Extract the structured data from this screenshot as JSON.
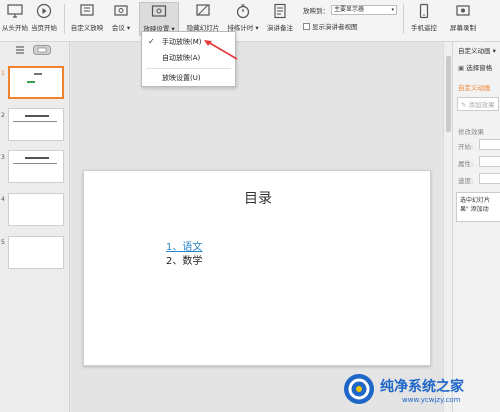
{
  "ribbon": {
    "buttons": [
      {
        "label": "从头开始",
        "icon": "monitor-play-icon"
      },
      {
        "label": "当页开始",
        "icon": "play-circle-icon"
      },
      {
        "label": "自定义放映",
        "icon": "custom-show-icon"
      },
      {
        "label": "会议",
        "icon": "meeting-icon"
      },
      {
        "label": "放映设置",
        "icon": "show-settings-icon"
      },
      {
        "label": "隐藏幻灯片",
        "icon": "hide-slide-icon"
      },
      {
        "label": "排练计时",
        "icon": "timer-icon"
      },
      {
        "label": "演讲备注",
        "icon": "notes-icon"
      },
      {
        "label": "手机遥控",
        "icon": "phone-remote-icon"
      },
      {
        "label": "屏幕录制",
        "icon": "screen-record-icon"
      }
    ],
    "show_on_label": "放映到：",
    "show_on_value": "主要显示器",
    "presenter_view_label": "显示演讲者视图"
  },
  "dropdown": {
    "items": [
      "手动放映(M)",
      "自动放映(A)",
      "放映设置(U)"
    ],
    "checked_index": 0
  },
  "thumbnails": {
    "numbers": [
      "1",
      "2",
      "3",
      "4",
      "5"
    ]
  },
  "slide": {
    "title": "目录",
    "items": [
      "1、语文",
      "2、数学"
    ]
  },
  "right_panel": {
    "header": "自定义动画",
    "select_pane": "选择窗格",
    "section_title": "自定义动画",
    "add_effect": "添加效果",
    "modify_effect": "修改效果",
    "start_label": "开始:",
    "property_label": "属性:",
    "speed_label": "速度:",
    "hint_line1": "选中幻灯片",
    "hint_line2": "果\" 添加动"
  },
  "watermark": {
    "title": "纯净系统之家",
    "url": "www.ycwjzy.com"
  },
  "colors": {
    "accent_orange": "#f0822e",
    "link_blue": "#2a86c8",
    "arrow_red": "#e23b3b"
  }
}
